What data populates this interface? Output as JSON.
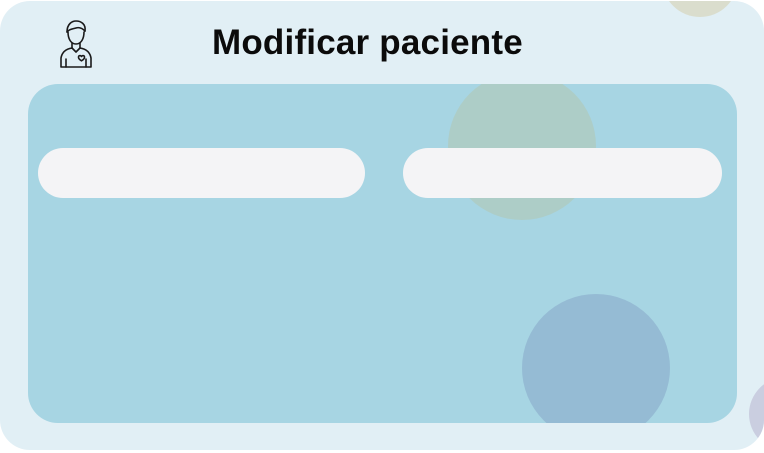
{
  "header": {
    "title": "Modificar paciente",
    "icon": "patient-heart-icon"
  },
  "form": {
    "field_left": {
      "value": "",
      "placeholder": ""
    },
    "field_right": {
      "value": "",
      "placeholder": ""
    }
  },
  "colors": {
    "card_background": "#e1eff5",
    "panel_background": "#a7d5e3",
    "field_background": "#f4f4f6",
    "title_text": "#0b0b0b"
  }
}
